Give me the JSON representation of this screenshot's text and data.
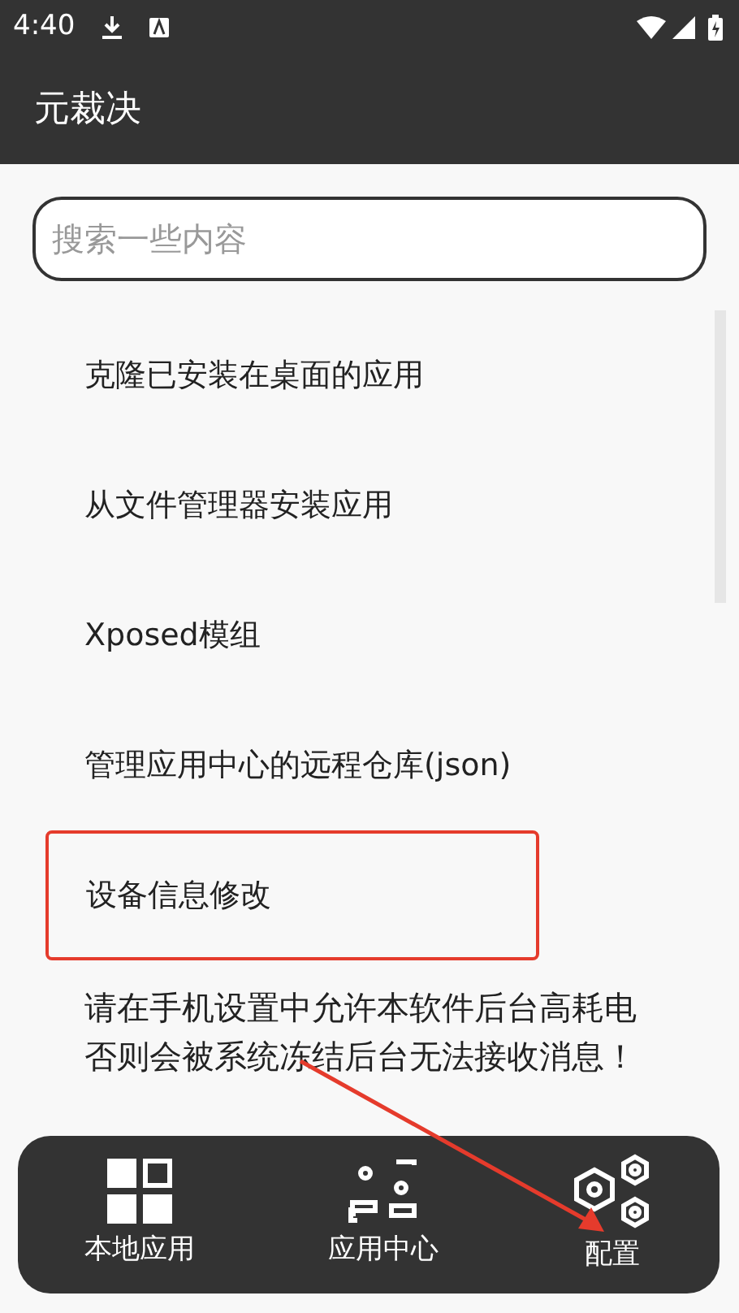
{
  "status_bar": {
    "time": "4:40"
  },
  "app_bar": {
    "title": "元裁决"
  },
  "search": {
    "placeholder": "搜索一些内容"
  },
  "items": [
    {
      "kind": "item",
      "label": "克隆已安装在桌面的应用",
      "highlighted": false
    },
    {
      "kind": "item",
      "label": "从文件管理器安装应用",
      "highlighted": false
    },
    {
      "kind": "item",
      "label": "Xposed模组",
      "highlighted": false
    },
    {
      "kind": "item",
      "label": "管理应用中心的远程仓库(json)",
      "highlighted": false
    },
    {
      "kind": "item",
      "label": "设备信息修改",
      "highlighted": true
    }
  ],
  "notice": "请在手机设置中允许本软件后台高耗电否则会被系统冻结后台无法接收消息！",
  "annotation_arrow": true,
  "bottom_nav": [
    {
      "kind": "local",
      "label": "本地应用"
    },
    {
      "kind": "center",
      "label": "应用中心"
    },
    {
      "kind": "config",
      "label": "配置"
    }
  ]
}
